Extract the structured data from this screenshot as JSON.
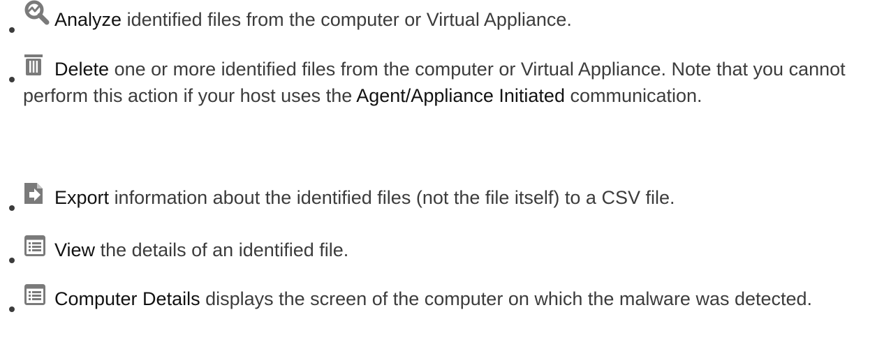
{
  "actions": [
    {
      "icon": "analyze-icon",
      "keyword": "Analyze",
      "description": "identified files from the computer or Virtual Appliance."
    },
    {
      "icon": "trash-icon",
      "keyword": "Delete",
      "description_start": "one or more identified files from the computer or Virtual Appliance. Note that you cannot perform this action if your host uses the",
      "emphasis": "Agent/Appliance Initiated",
      "description_end": "communication."
    },
    {
      "icon": "export-icon",
      "keyword": "Export",
      "description": "information about the identified files (not the file itself) to a CSV file."
    },
    {
      "icon": "details-window-icon",
      "keyword": "View",
      "description": "the details of an identified file."
    },
    {
      "icon": "details-window-icon",
      "keyword": "Computer Details",
      "description": "displays the screen of the computer on which the malware was detected."
    }
  ],
  "colors": {
    "text": "#3c3c3c",
    "icon": "#7a7a7a"
  }
}
